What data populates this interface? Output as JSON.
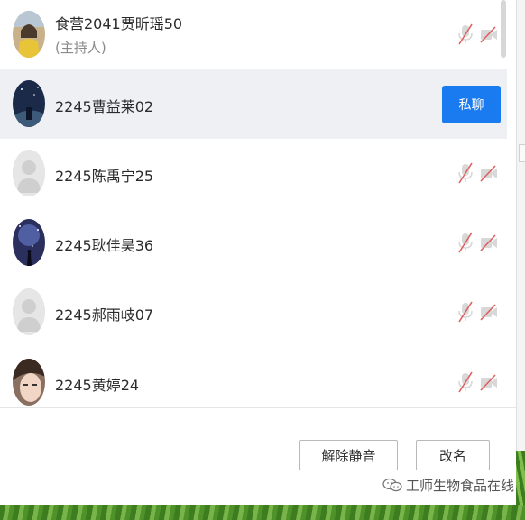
{
  "participants": [
    {
      "name": "食营2041贾昕瑶50",
      "role": "(主持人)",
      "avatar": "photo-girl-yellow",
      "selected": false
    },
    {
      "name": "2245曹益莱02",
      "role": "",
      "avatar": "photo-night-sky",
      "selected": true
    },
    {
      "name": "2245陈禹宁25",
      "role": "",
      "avatar": "default-user",
      "selected": false
    },
    {
      "name": "2245耿佳昊36",
      "role": "",
      "avatar": "photo-galaxy",
      "selected": false
    },
    {
      "name": "2245郝雨岐07",
      "role": "",
      "avatar": "default-user",
      "selected": false
    },
    {
      "name": "2245黄婷24",
      "role": "",
      "avatar": "photo-face",
      "selected": false
    }
  ],
  "actions": {
    "private_chat_label": "私聊",
    "unmute_label": "解除静音",
    "rename_label": "改名"
  },
  "icons": {
    "mic": "mic-muted-icon",
    "camera": "camera-off-icon"
  },
  "watermark": {
    "text": "工师生物食品在线",
    "icon": "wechat-icon"
  },
  "colors": {
    "accent": "#1a7bf0",
    "muted_red": "#e06060",
    "selected_row": "#eef0f4"
  }
}
